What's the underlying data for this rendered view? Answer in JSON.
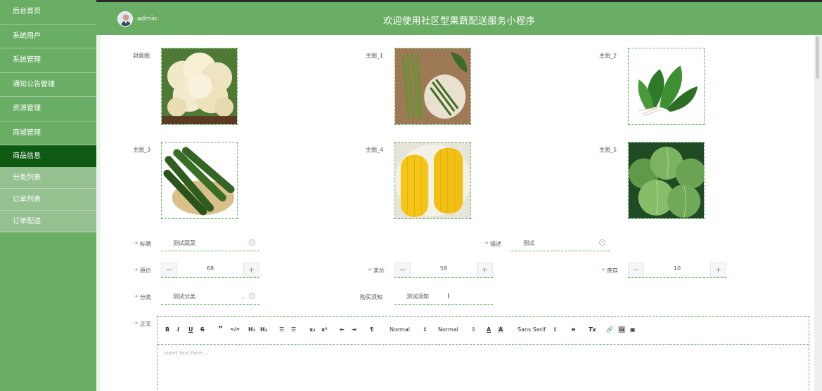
{
  "sidebar": {
    "items": [
      {
        "label": "后台首页"
      },
      {
        "label": "系统用户"
      },
      {
        "label": "系统管理"
      },
      {
        "label": "通知公告管理"
      },
      {
        "label": "资源管理"
      },
      {
        "label": "商城管理"
      },
      {
        "label": "商品信息"
      }
    ],
    "sub_items": [
      {
        "label": "分类列表"
      },
      {
        "label": "订单列表"
      },
      {
        "label": "订单配送"
      }
    ]
  },
  "header": {
    "username": "admin",
    "title": "欢迎使用社区型果蔬配送服务小程序"
  },
  "images": [
    {
      "label": "封面图",
      "subject": "cauliflower"
    },
    {
      "label": "主图_1",
      "subject": "asparagus"
    },
    {
      "label": "主图_2",
      "subject": "spinach"
    },
    {
      "label": "主图_3",
      "subject": "cucumber"
    },
    {
      "label": "主图_4",
      "subject": "corn"
    },
    {
      "label": "主图_5",
      "subject": "cabbage"
    }
  ],
  "form": {
    "title_label": "标题",
    "title_value": "测试蔬菜",
    "desc_label": "描述",
    "desc_value": "测试",
    "orig_price_label": "原价",
    "orig_price_value": "68",
    "sale_price_label": "卖价",
    "sale_price_value": "58",
    "stock_label": "库存",
    "stock_value": "10",
    "category_label": "分类",
    "category_value": "测试分类",
    "notice_label": "购买须知",
    "notice_value": "测试须知",
    "body_label": "正文"
  },
  "editor": {
    "toolbar": {
      "bold": "B",
      "italic": "I",
      "underline": "U",
      "strike": "S",
      "quote": "”",
      "code": "</>",
      "h1": "H₁",
      "h2": "H₂",
      "ol": "☰",
      "ul": "☰",
      "sub": "x₂",
      "sup": "x²",
      "indent_less": "⇤",
      "indent_more": "⇥",
      "rtl": "¶",
      "size_select": "Normal",
      "header_select": "Normal",
      "color": "A",
      "background": "A",
      "font_select": "Sans Serif",
      "align": "≡",
      "clean": "Tx",
      "link": "🔗",
      "image": "🖼",
      "video": "▣"
    },
    "placeholder": "Insert text here ..."
  },
  "colors": {
    "brand": "#6aad65",
    "active": "#0e5a12",
    "sub_menu": "#95c190"
  }
}
